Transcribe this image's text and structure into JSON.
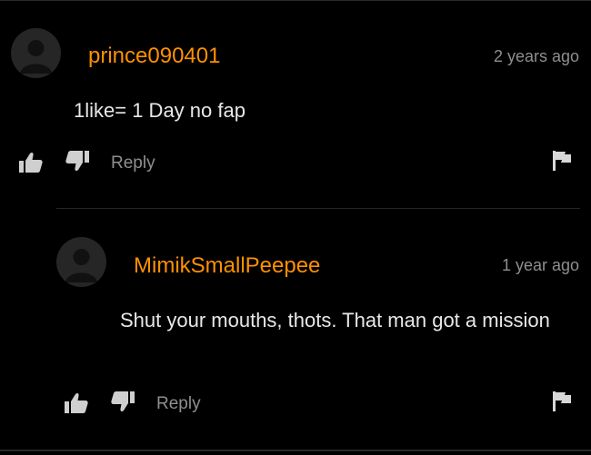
{
  "comments": [
    {
      "username": "prince090401",
      "timestamp": "2 years ago",
      "text": "1like= 1 Day no fap",
      "reply_label": "Reply"
    },
    {
      "username": "MimikSmallPeepee",
      "timestamp": "1 year ago",
      "text": "Shut your mouths, thots. That man got a mission",
      "reply_label": "Reply"
    }
  ],
  "colors": {
    "background": "#000000",
    "username": "#ff9000",
    "muted": "#8f8f8f",
    "text": "#e8e8e8",
    "avatar": "#262626"
  },
  "icons": [
    "avatar-silhouette-icon",
    "thumbs-up-icon",
    "thumbs-down-icon",
    "flag-icon"
  ]
}
